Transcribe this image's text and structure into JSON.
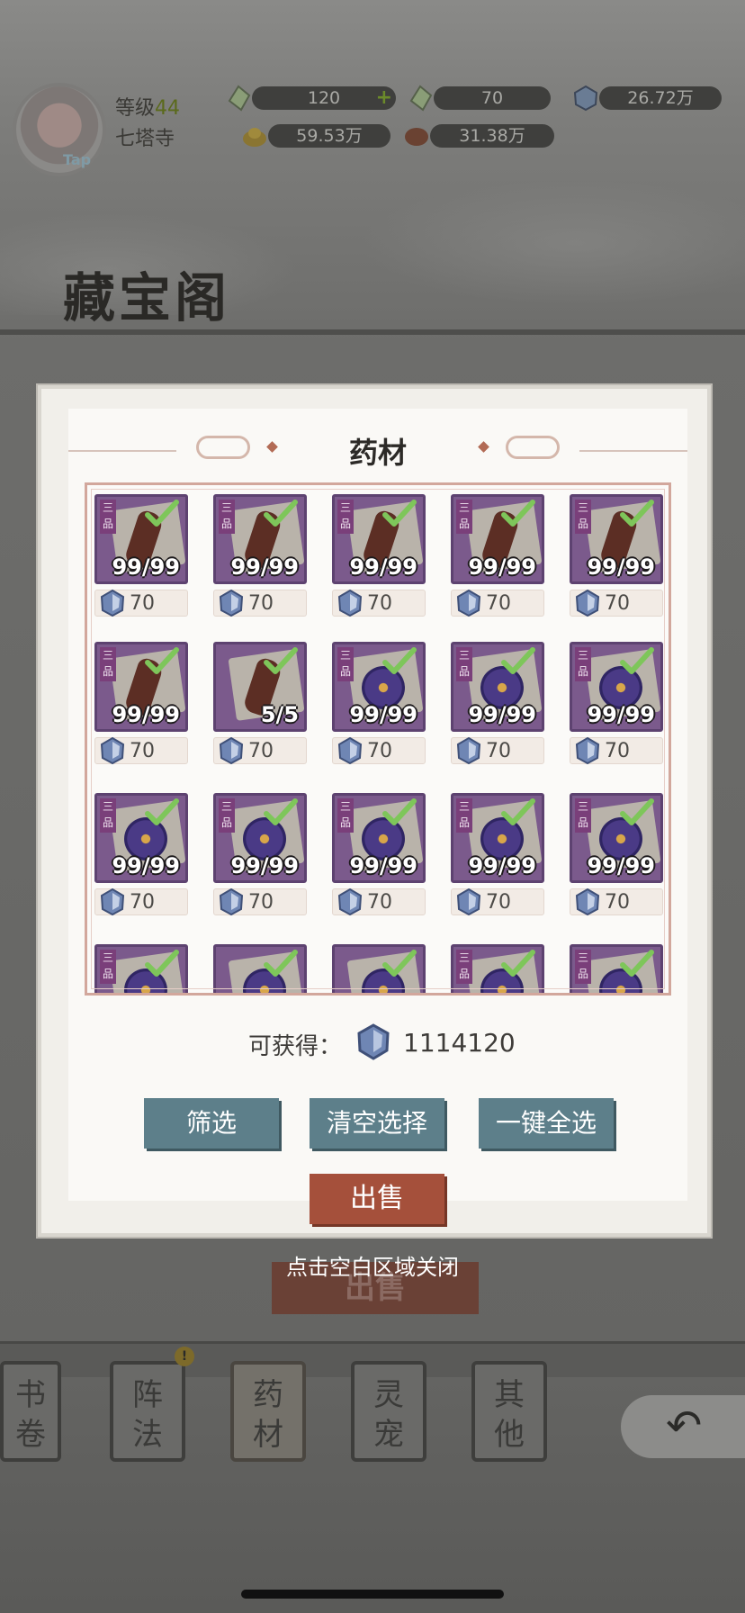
{
  "hud": {
    "avatar_tag": "Tap",
    "level_label": "等级",
    "level_value": "44",
    "place": "七塔寺",
    "resources": [
      {
        "icon": "rainbow-crystal-icon",
        "value": "120",
        "has_plus": true
      },
      {
        "icon": "rainbow-crystal-icon",
        "value": "70"
      },
      {
        "icon": "spirit-stone-icon",
        "value": "26.72万"
      },
      {
        "icon": "gold-ingot-icon",
        "value": "59.53万"
      },
      {
        "icon": "meat-icon",
        "value": "31.38万"
      }
    ]
  },
  "page_title": "藏宝阁",
  "modal": {
    "title": "药材",
    "items": [
      {
        "herb": "root",
        "grade": "三品",
        "count": "99/99",
        "price": "70",
        "selected": true
      },
      {
        "herb": "root",
        "grade": "三品",
        "count": "99/99",
        "price": "70",
        "selected": true
      },
      {
        "herb": "root",
        "grade": "三品",
        "count": "99/99",
        "price": "70",
        "selected": true
      },
      {
        "herb": "root",
        "grade": "三品",
        "count": "99/99",
        "price": "70",
        "selected": true
      },
      {
        "herb": "root",
        "grade": "三品",
        "count": "99/99",
        "price": "70",
        "selected": true
      },
      {
        "herb": "root",
        "grade": "三品",
        "count": "99/99",
        "price": "70",
        "selected": true
      },
      {
        "herb": "root",
        "grade": "",
        "count": "5/5",
        "price": "70",
        "selected": true
      },
      {
        "herb": "flower",
        "grade": "三品",
        "count": "99/99",
        "price": "70",
        "selected": true
      },
      {
        "herb": "flower",
        "grade": "三品",
        "count": "99/99",
        "price": "70",
        "selected": true
      },
      {
        "herb": "flower",
        "grade": "三品",
        "count": "99/99",
        "price": "70",
        "selected": true
      },
      {
        "herb": "flower",
        "grade": "三品",
        "count": "99/99",
        "price": "70",
        "selected": true
      },
      {
        "herb": "flower",
        "grade": "三品",
        "count": "99/99",
        "price": "70",
        "selected": true
      },
      {
        "herb": "flower",
        "grade": "三品",
        "count": "99/99",
        "price": "70",
        "selected": true
      },
      {
        "herb": "flower",
        "grade": "三品",
        "count": "99/99",
        "price": "70",
        "selected": true
      },
      {
        "herb": "flower",
        "grade": "三品",
        "count": "99/99",
        "price": "70",
        "selected": true
      },
      {
        "herb": "flower",
        "grade": "三品",
        "count": "",
        "price": "",
        "selected": true
      },
      {
        "herb": "flower",
        "grade": "",
        "count": "",
        "price": "",
        "selected": true
      },
      {
        "herb": "flower",
        "grade": "",
        "count": "",
        "price": "",
        "selected": true
      },
      {
        "herb": "flower",
        "grade": "三品",
        "count": "",
        "price": "",
        "selected": true
      },
      {
        "herb": "flower",
        "grade": "三品",
        "count": "",
        "price": "",
        "selected": true
      }
    ],
    "obtain_label": "可获得：",
    "obtain_value": "1114120",
    "buttons": {
      "filter": "筛选",
      "clear": "清空选择",
      "select_all": "一键全选",
      "sell": "出售"
    },
    "close_hint": "点击空白区域关闭"
  },
  "background": {
    "sell_button": "出售",
    "tabs": [
      {
        "label": "书\n卷"
      },
      {
        "label": "阵\n法"
      },
      {
        "label": "药\n材",
        "active": true
      },
      {
        "label": "灵\n宠"
      },
      {
        "label": "其\n他"
      }
    ]
  },
  "colors": {
    "item_purple": "#7b5a8c",
    "button_teal": "#5d7f8a",
    "sell_red": "#a5503b",
    "check_green": "#7ec65a",
    "gem_blue": "#6f86b4"
  }
}
